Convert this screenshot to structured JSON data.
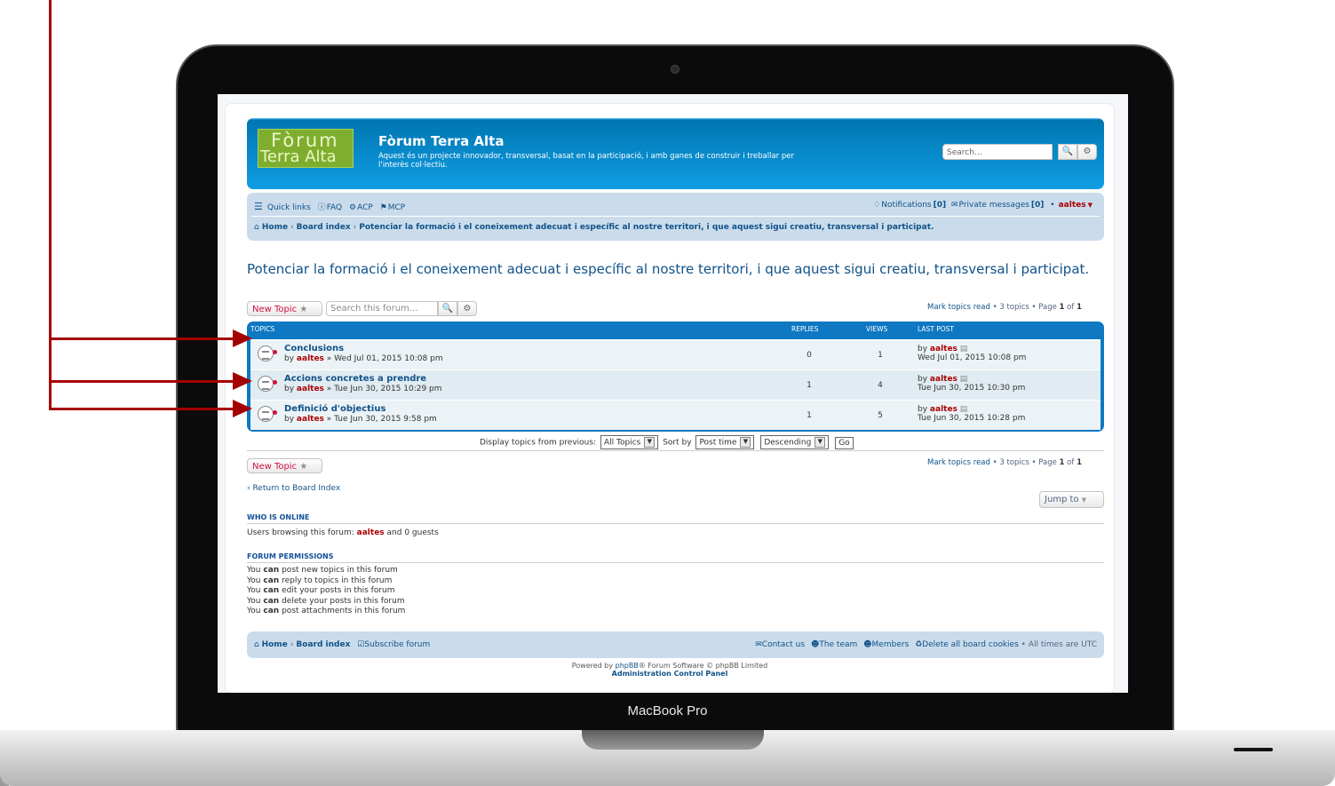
{
  "device": {
    "label": "MacBook Pro"
  },
  "site": {
    "logo_line1": "Fòrum",
    "logo_line2": "Terra Alta",
    "title": "Fòrum Terra Alta",
    "description": "Aquest és un projecte innovador, transversal, basat en la participació, i amb ganes de construir i treballar per l'interès col·lectiu.",
    "search_placeholder": "Search…"
  },
  "navbar": {
    "quick_links": "Quick links",
    "faq": "FAQ",
    "acp": "ACP",
    "mcp": "MCP",
    "notifications": "Notifications",
    "notifications_count": "[0]",
    "private_messages": "Private messages",
    "pm_count": "[0]",
    "bullet": "•",
    "username": "aaltes"
  },
  "breadcrumbs": [
    "Home",
    "Board index",
    "Potenciar la formació i el coneixement adecuat i específic al nostre territori, i que aquest sigui creatiu, transversal i participat."
  ],
  "page_title": "Potenciar la formació i el coneixement adecuat i específic al nostre territori, i que aquest sigui creatiu, transversal i participat.",
  "actions": {
    "new_topic": "New Topic",
    "forum_search_placeholder": "Search this forum…",
    "pagination_top": {
      "mark": "Mark topics read",
      "count": "3 topics",
      "page_label": "Page",
      "page": "1",
      "of": "of",
      "total": "1"
    }
  },
  "topics_table": {
    "headers": {
      "topics": "TOPICS",
      "replies": "REPLIES",
      "views": "VIEWS",
      "last_post": "LAST POST"
    },
    "rows": [
      {
        "title": "Conclusions",
        "by": "by",
        "author": "aaltes",
        "date": "» Wed Jul 01, 2015 10:08 pm",
        "replies": "0",
        "views": "1",
        "last_by": "by",
        "last_author": "aaltes",
        "last_date": "Wed Jul 01, 2015 10:08 pm"
      },
      {
        "title": "Accions concretes a prendre",
        "by": "by",
        "author": "aaltes",
        "date": "» Tue Jun 30, 2015 10:29 pm",
        "replies": "1",
        "views": "4",
        "last_by": "by",
        "last_author": "aaltes",
        "last_date": "Tue Jun 30, 2015 10:30 pm"
      },
      {
        "title": "Definició d'objectius",
        "by": "by",
        "author": "aaltes",
        "date": "» Tue Jun 30, 2015 9:58 pm",
        "replies": "1",
        "views": "5",
        "last_by": "by",
        "last_author": "aaltes",
        "last_date": "Tue Jun 30, 2015 10:28 pm"
      }
    ]
  },
  "display_options": {
    "label": "Display topics from previous:",
    "period": "All Topics",
    "sort_label": "Sort by",
    "sort_key": "Post time",
    "sort_dir": "Descending",
    "go": "Go"
  },
  "return_link": "‹ Return to Board Index",
  "jump_to": "Jump to",
  "who_is_online": {
    "heading": "WHO IS ONLINE",
    "text_prefix": "Users browsing this forum:",
    "user": "aaltes",
    "text_suffix": "and 0 guests"
  },
  "permissions": {
    "heading": "FORUM PERMISSIONS",
    "you": "You",
    "can": "can",
    "lines": [
      "post new topics in this forum",
      "reply to topics in this forum",
      "edit your posts in this forum",
      "delete your posts in this forum",
      "post attachments in this forum"
    ]
  },
  "footer": {
    "home": "Home",
    "board_index": "Board index",
    "subscribe": "Subscribe forum",
    "contact": "Contact us",
    "team": "The team",
    "members": "Members",
    "delete_cookies": "Delete all board cookies",
    "timezone": "• All times are UTC"
  },
  "powered": {
    "prefix": "Powered by",
    "phpbb": "phpBB",
    "suffix": "® Forum Software © phpBB Limited",
    "acp": "Administration Control Panel"
  },
  "colors": {
    "accent": "#105289",
    "header_blue": "#12A3EB",
    "arrow": "#a50000",
    "username": "#aa0000"
  }
}
